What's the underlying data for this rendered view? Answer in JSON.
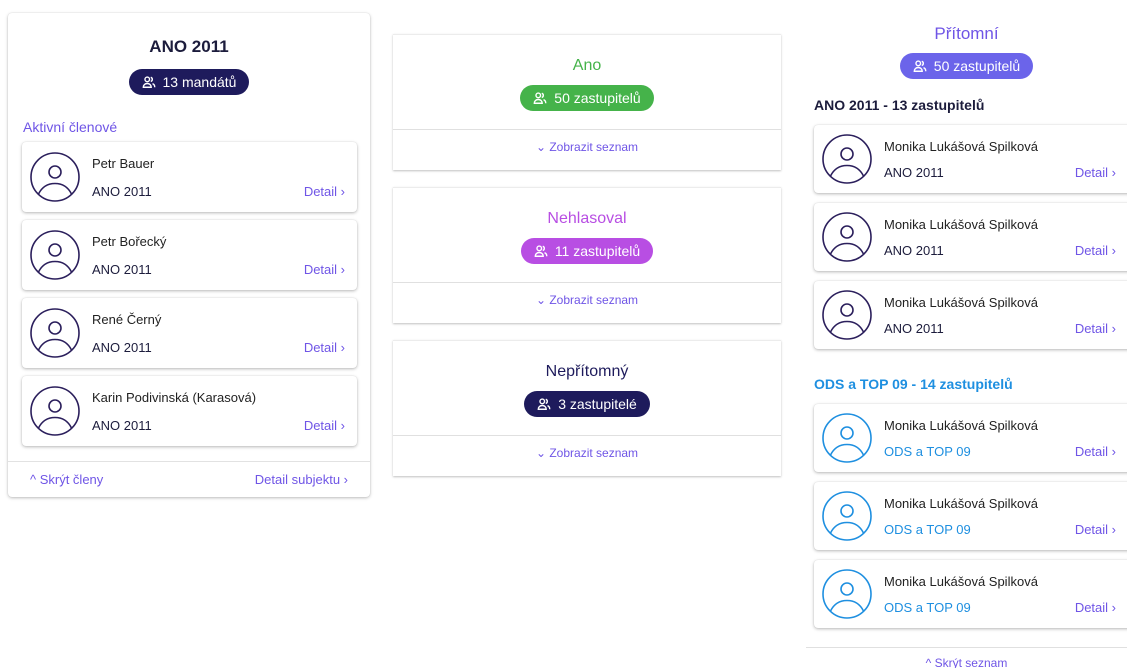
{
  "colors": {
    "accent": "#6f55e6",
    "navy": "#1e1b5c",
    "green": "#45b34a",
    "purple": "#b84ee3",
    "blue": "#1e8fe0",
    "violet": "#6b64ea"
  },
  "icons": {
    "people": "people-icon",
    "avatar": "user-avatar-icon",
    "chevron_right": "chevron-right-icon",
    "chevron_down": "chevron-down-icon",
    "chevron_up": "chevron-up-icon"
  },
  "party_panel": {
    "title": "ANO 2011",
    "chip": "13 mandátů",
    "section_label": "Aktivní členové",
    "members": [
      {
        "name": "Petr Bauer",
        "party": "ANO 2011",
        "detail": "Detail ›"
      },
      {
        "name": "Petr Bořecký",
        "party": "ANO 2011",
        "detail": "Detail ›"
      },
      {
        "name": "René Černý",
        "party": "ANO 2011",
        "detail": "Detail ›"
      },
      {
        "name": "Karin Podivinská (Karasová)",
        "party": "ANO 2011",
        "detail": "Detail ›"
      }
    ],
    "hide_members": "^ Skrýt členy",
    "subject_detail": "Detail subjektu ›"
  },
  "vote_panel": {
    "groups": [
      {
        "title": "Ano",
        "chip": "50 zastupitelů",
        "show": "⌄ Zobrazit seznam"
      },
      {
        "title": "Nehlasoval",
        "chip": "11 zastupitelů",
        "show": "⌄ Zobrazit seznam"
      },
      {
        "title": "Nepřítomný",
        "chip": "3 zastupitelé",
        "show": "⌄ Zobrazit seznam"
      }
    ]
  },
  "present_panel": {
    "title": "Přítomní",
    "chip": "50 zastupitelů",
    "groups": [
      {
        "heading": "ANO 2011 - 13 zastupitelů",
        "members": [
          {
            "name": "Monika Lukášová Spilková",
            "party": "ANO 2011",
            "detail": "Detail ›"
          },
          {
            "name": "Monika Lukášová Spilková",
            "party": "ANO 2011",
            "detail": "Detail ›"
          },
          {
            "name": "Monika Lukášová Spilková",
            "party": "ANO 2011",
            "detail": "Detail ›"
          }
        ]
      },
      {
        "heading": "ODS a TOP 09 - 14 zastupitelů",
        "members": [
          {
            "name": "Monika Lukášová Spilková",
            "party": "ODS a TOP 09",
            "detail": "Detail ›"
          },
          {
            "name": "Monika Lukášová Spilková",
            "party": "ODS a TOP 09",
            "detail": "Detail ›"
          },
          {
            "name": "Monika Lukášová Spilková",
            "party": "ODS a TOP 09",
            "detail": "Detail ›"
          }
        ]
      }
    ],
    "hide_list": "^ Skrýt seznam"
  }
}
